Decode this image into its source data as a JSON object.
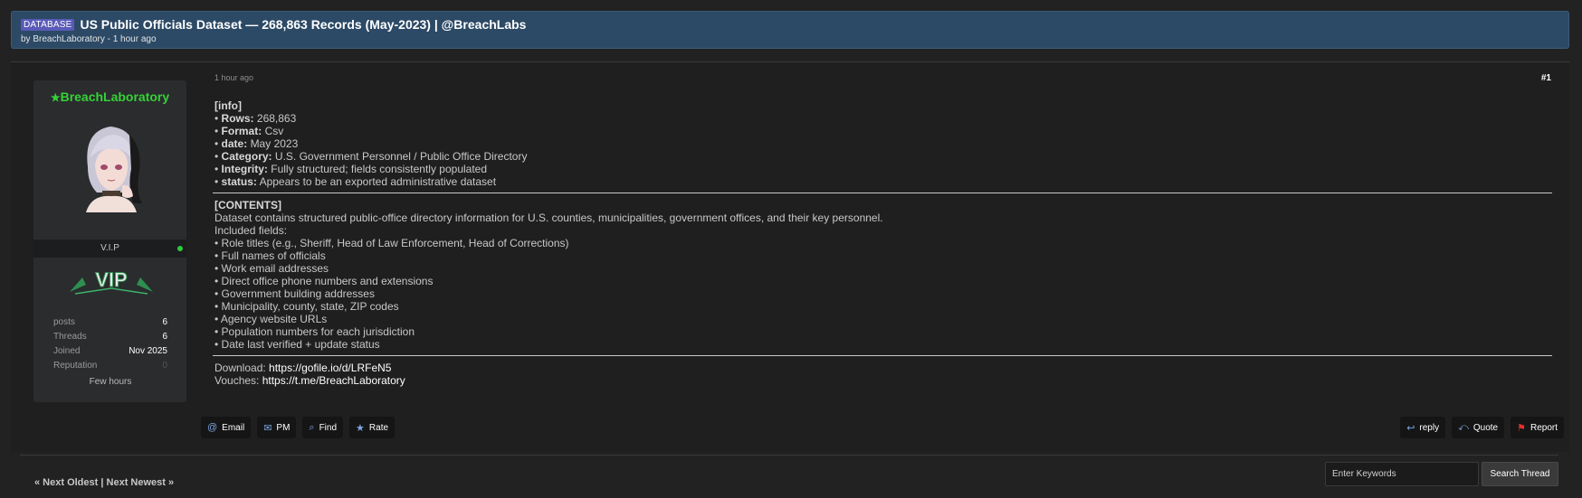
{
  "header": {
    "tag": "DATABASE",
    "title": "US Public Officials Dataset — 268,863 Records (May-2023) | @BreachLabs",
    "subtitle": "by BreachLaboratory - 1 hour ago"
  },
  "user": {
    "name": "BreachLaboratory",
    "rank": "V.I.P",
    "badge": "VIP",
    "stats": [
      {
        "key": "posts",
        "value": "6"
      },
      {
        "key": "Threads",
        "value": "6"
      },
      {
        "key": "Joined",
        "value": "Nov 2025"
      },
      {
        "key": "Reputation",
        "value": "0"
      }
    ],
    "last_seen": "Few hours"
  },
  "post": {
    "time": "1 hour ago",
    "number": "#1",
    "info_heading": "[info]",
    "info_items": [
      {
        "label": "Rows:",
        "value": "268,863"
      },
      {
        "label": "Format:",
        "value": "Csv"
      },
      {
        "label": "date:",
        "value": "May 2023"
      },
      {
        "label": "Category:",
        "value": "U.S. Government Personnel / Public Office Directory"
      },
      {
        "label": "Integrity:",
        "value": "Fully structured; fields consistently populated"
      },
      {
        "label": "status:",
        "value": "Appears to be an exported administrative dataset"
      }
    ],
    "contents_heading": "[CONTENTS]",
    "contents_desc": "Dataset contains structured public-office directory information for U.S. counties, municipalities, government offices, and their key personnel.",
    "fields_intro": "Included fields:",
    "fields": [
      "Role titles (e.g., Sheriff, Head of Law Enforcement, Head of Corrections)",
      "Full names of officials",
      "Work email addresses",
      "Direct office phone numbers and extensions",
      "Government building addresses",
      "Municipality, county, state, ZIP codes",
      "Agency website URLs",
      "Population numbers for each jurisdiction",
      "Date last verified + update status"
    ],
    "download_label": "Download:",
    "download_url": "https://gofile.io/d/LRFeN5",
    "vouches_label": "Vouches:",
    "vouches_url": "https://t.me/BreachLaboratory"
  },
  "actions_left": [
    "Email",
    "PM",
    "Find",
    "Rate"
  ],
  "actions_right": [
    "reply",
    "Quote",
    "Report"
  ],
  "footer": {
    "nav_prev": "« Next Oldest",
    "nav_sep": "|",
    "nav_next": "Next Newest »",
    "search_placeholder": "Enter Keywords",
    "search_button": "Search Thread"
  },
  "colors": {
    "header_bg": "#2c4a66",
    "username": "#36d136",
    "online": "#2ecc40",
    "report_flag": "#e23030"
  }
}
